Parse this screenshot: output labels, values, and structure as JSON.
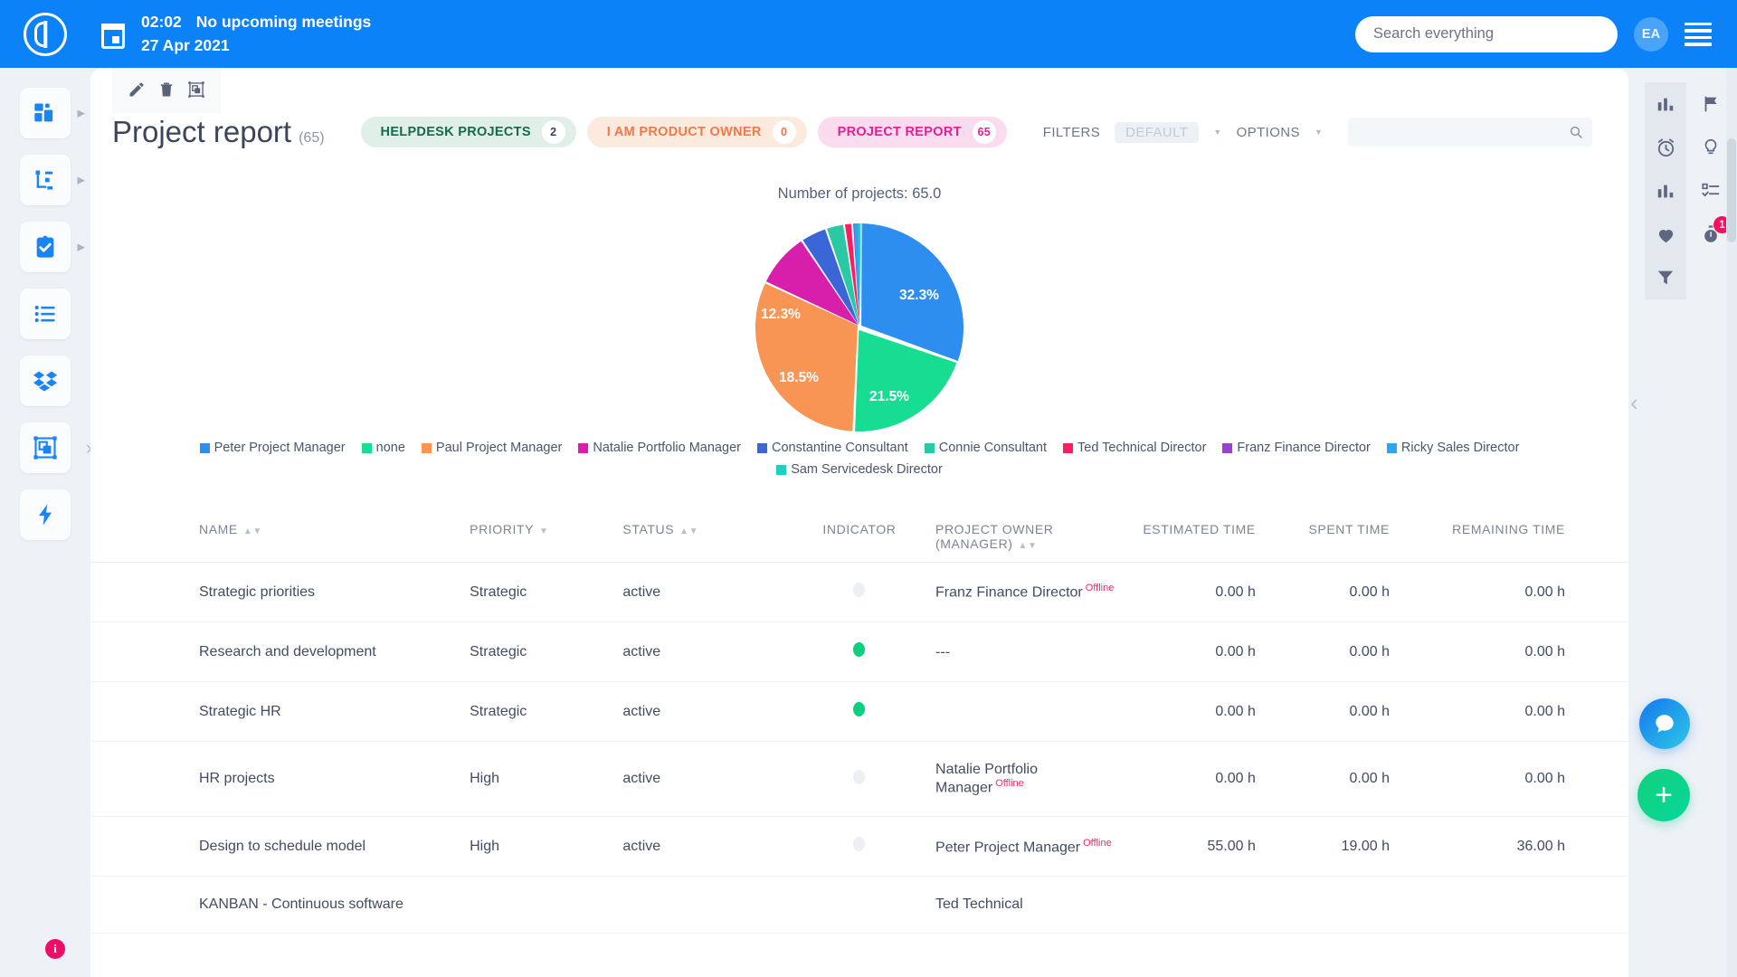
{
  "topbar": {
    "logo": "power-logo-icon",
    "calendar_icon": "calendar-icon",
    "time": "02:02",
    "meeting_status": "No upcoming meetings",
    "date": "27 Apr 2021",
    "search_placeholder": "Search everything",
    "search_value": "",
    "avatar_initials": "EA",
    "menu_icon": "hamburger-menu-icon",
    "accent_color": "#0b82f8"
  },
  "left_rail": {
    "items": [
      {
        "name": "dashboard-icon",
        "has_arrow": true
      },
      {
        "name": "hierarchy-icon",
        "has_arrow": true
      },
      {
        "name": "tasks-clipboard-icon",
        "has_arrow": true
      },
      {
        "name": "list-icon",
        "has_arrow": false
      },
      {
        "name": "dropbox-icon",
        "has_arrow": false
      },
      {
        "name": "project-frame-icon",
        "has_arrow": false
      },
      {
        "name": "lightning-icon",
        "has_arrow": false
      }
    ],
    "expand_chevron": "›",
    "info_badge": "i"
  },
  "right_rail": {
    "left_column": [
      {
        "name": "bar-chart-icon",
        "shaded": true,
        "badge": ""
      },
      {
        "name": "alarm-clock-icon",
        "shaded": true,
        "badge": ""
      },
      {
        "name": "bar-chart-icon",
        "shaded": true,
        "badge": ""
      },
      {
        "name": "heart-icon",
        "shaded": true,
        "badge": ""
      },
      {
        "name": "funnel-filter-icon",
        "shaded": true,
        "badge": ""
      }
    ],
    "right_column": [
      {
        "name": "flag-icon",
        "shaded": false,
        "badge": ""
      },
      {
        "name": "lightbulb-icon",
        "shaded": false,
        "badge": ""
      },
      {
        "name": "checklist-icon",
        "shaded": false,
        "badge": ""
      },
      {
        "name": "stopwatch-icon",
        "shaded": false,
        "badge": "1"
      }
    ],
    "collapse_chevron": "‹",
    "badge_color": "#f4125f"
  },
  "toolbar": {
    "edit_icon": "pencil-edit-icon",
    "delete_icon": "trash-delete-icon",
    "frame_icon": "project-frame-icon"
  },
  "header": {
    "title": "Project report",
    "title_count": "(65)",
    "pills": [
      {
        "label": "HELPDESK PROJECTS",
        "count": "2",
        "style": "pill-green"
      },
      {
        "label": "I AM PRODUCT OWNER",
        "count": "0",
        "style": "pill-orange"
      },
      {
        "label": "PROJECT REPORT",
        "count": "65",
        "style": "pill-pink"
      }
    ],
    "filters_label": "FILTERS",
    "filters_value": "DEFAULT",
    "options_label": "OPTIONS",
    "search_placeholder": "",
    "search_value": "",
    "search_icon": "search-icon"
  },
  "chart_data": {
    "type": "pie",
    "title": "Number of projects: 65.0",
    "xlabel": "",
    "ylabel": "",
    "legend_position": "bottom",
    "categories": [
      "Peter Project Manager",
      "none",
      "Paul Project Manager",
      "Natalie Portfolio Manager",
      "Constantine Consultant",
      "Connie Consultant",
      "Ted Technical Director",
      "Franz Finance Director",
      "Ricky Sales Director",
      "Sam Servicedesk Director"
    ],
    "values": [
      32.3,
      21.5,
      18.5,
      12.3,
      6.2,
      4.6,
      1.5,
      1.5,
      1.0,
      0.6
    ],
    "value_unit": "%",
    "visible_labels": [
      "32.3%",
      "21.5%",
      "18.5%",
      "12.3%"
    ],
    "colors": [
      "#2e8ef0",
      "#17dd93",
      "#f89555",
      "#d81fab",
      "#3a66d8",
      "#2ac9a4",
      "#f42060",
      "#9c3fd4",
      "#2aa8ef",
      "#21cfc0"
    ],
    "total_label": "Number of projects: 65.0",
    "total": 65.0
  },
  "table": {
    "columns": [
      {
        "label": "NAME",
        "sortable": true,
        "align": "left"
      },
      {
        "label": "PRIORITY",
        "sortable": true,
        "align": "left"
      },
      {
        "label": "STATUS",
        "sortable": true,
        "align": "left"
      },
      {
        "label": "INDICATOR",
        "sortable": false,
        "align": "center"
      },
      {
        "label": "PROJECT OWNER (MANAGER)",
        "sortable": true,
        "align": "left"
      },
      {
        "label": "ESTIMATED TIME",
        "sortable": false,
        "align": "right"
      },
      {
        "label": "SPENT TIME",
        "sortable": false,
        "align": "right"
      },
      {
        "label": "REMAINING TIME",
        "sortable": false,
        "align": "right"
      }
    ],
    "rows": [
      {
        "name": "Strategic priorities",
        "priority": "Strategic",
        "status": "active",
        "indicator": "grey",
        "owner": "Franz Finance Director",
        "owner_status": "Offline",
        "estimated": "0.00 h",
        "spent": "0.00 h",
        "remaining": "0.00 h"
      },
      {
        "name": "Research and development",
        "priority": "Strategic",
        "status": "active",
        "indicator": "green",
        "owner": "---",
        "owner_status": "",
        "estimated": "0.00 h",
        "spent": "0.00 h",
        "remaining": "0.00 h"
      },
      {
        "name": "Strategic HR",
        "priority": "Strategic",
        "status": "active",
        "indicator": "green",
        "owner": "",
        "owner_status": "",
        "estimated": "0.00 h",
        "spent": "0.00 h",
        "remaining": "0.00 h"
      },
      {
        "name": "HR projects",
        "priority": "High",
        "status": "active",
        "indicator": "grey",
        "owner": "Natalie Portfolio Manager",
        "owner_status": "Offline",
        "estimated": "0.00 h",
        "spent": "0.00 h",
        "remaining": "0.00 h"
      },
      {
        "name": "Design to schedule model",
        "priority": "High",
        "status": "active",
        "indicator": "grey",
        "owner": "Peter Project Manager",
        "owner_status": "Offline",
        "estimated": "55.00 h",
        "spent": "19.00 h",
        "remaining": "36.00 h"
      },
      {
        "name": "KANBAN - Continuous software",
        "priority": "",
        "status": "",
        "indicator": "none",
        "owner": "Ted Technical",
        "owner_status": "",
        "estimated": "",
        "spent": "",
        "remaining": ""
      }
    ]
  },
  "floating": {
    "chat_icon": "chat-bubble-icon",
    "add_label": "+"
  }
}
